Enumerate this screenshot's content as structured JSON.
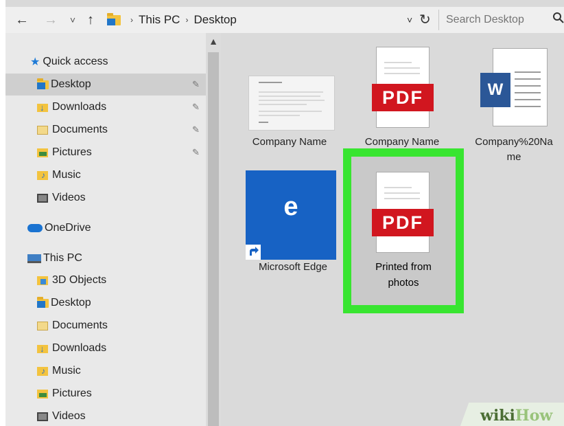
{
  "address_bar": {
    "back": "←",
    "forward": "→",
    "recent": "˅",
    "up": "↑",
    "path": [
      "This PC",
      "Desktop"
    ],
    "separator": "›",
    "dropdown": "˅",
    "refresh": "↻",
    "search_placeholder": "Search Desktop",
    "search_icon": "magnifier-icon"
  },
  "sidebar": {
    "quick_access_label": "Quick access",
    "quick_access": [
      {
        "label": "Desktop",
        "icon": "desktop-folder-icon",
        "pinned": true,
        "selected": true
      },
      {
        "label": "Downloads",
        "icon": "downloads-folder-icon",
        "pinned": true
      },
      {
        "label": "Documents",
        "icon": "documents-folder-icon",
        "pinned": true
      },
      {
        "label": "Pictures",
        "icon": "pictures-folder-icon",
        "pinned": true
      },
      {
        "label": "Music",
        "icon": "music-folder-icon"
      },
      {
        "label": "Videos",
        "icon": "videos-folder-icon"
      }
    ],
    "onedrive_label": "OneDrive",
    "thispc_label": "This PC",
    "this_pc": [
      {
        "label": "3D Objects"
      },
      {
        "label": "Desktop"
      },
      {
        "label": "Documents"
      },
      {
        "label": "Downloads"
      },
      {
        "label": "Music"
      },
      {
        "label": "Pictures"
      },
      {
        "label": "Videos"
      }
    ],
    "pin_glyph": "📌"
  },
  "files": [
    {
      "name": "Company Name",
      "type": "text-document"
    },
    {
      "name": "Company Name",
      "type": "pdf",
      "badge": "PDF"
    },
    {
      "name_line1": "Company%20Na",
      "name_line2": "me",
      "type": "word",
      "badge": "W"
    },
    {
      "name": "Microsoft Edge",
      "type": "shortcut",
      "badge": "e"
    },
    {
      "name_line1": "Printed from",
      "name_line2": "photos",
      "type": "pdf",
      "badge": "PDF",
      "highlighted": true
    }
  ],
  "colors": {
    "highlight": "#38e530",
    "pdf_red": "#d1161f",
    "edge_blue": "#1762c4",
    "word_blue": "#2b5797"
  },
  "watermark": {
    "part1": "wiki",
    "part2": "How"
  }
}
